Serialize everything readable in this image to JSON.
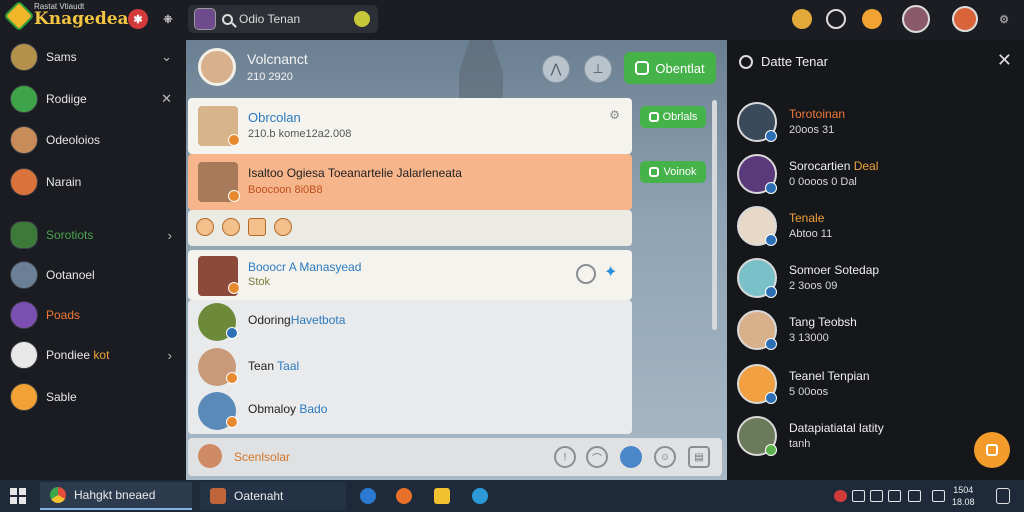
{
  "app": {
    "brand_sub": "Rastat Vtiaudt",
    "brand_name": "Knagedeaf"
  },
  "topbar": {
    "search_text": "Odio Tenan"
  },
  "sidebar": {
    "items": [
      {
        "label": "Sams",
        "alt": "",
        "right": "⌄",
        "color": "#b5924c"
      },
      {
        "label": "Rodiige",
        "alt": "",
        "right": "✕",
        "color": "#3fa34a"
      },
      {
        "label": "Odeoloios",
        "alt": "",
        "right": "",
        "color": "#c88b5a"
      },
      {
        "label": "Narain",
        "alt": "",
        "right": "",
        "color": "#d9733b"
      },
      {
        "label": "Sorotiots",
        "alt": "",
        "right": "›",
        "color": "#3d7a3a"
      },
      {
        "label": "Ootanoel",
        "alt": "",
        "right": "",
        "color": "#6b8096"
      },
      {
        "label": "Poads",
        "alt": "",
        "right": "",
        "color": "#7a4fb1"
      },
      {
        "label": "Pondiee",
        "alt": "kot",
        "right": "›",
        "color": "#e8e8e8"
      },
      {
        "label": "Sable",
        "alt": "",
        "right": "",
        "color": "#f2a135"
      }
    ]
  },
  "chat": {
    "title": "Volcnanct",
    "subtitle": "210 2920",
    "action_button": "Obentlat",
    "messages": [
      {
        "name": "Obrcolan",
        "line": "210.b kome12a2.008",
        "text": "",
        "text_blue": "",
        "button": "Obrlals",
        "av": "#d8b48a"
      },
      {
        "name": "",
        "line": "Boocoon 8i0B8",
        "text": "Isaltoo Ogiesa Toeanartelie Jalarleneata",
        "text_blue": "",
        "button": "Voinok",
        "av": "#a87a5a"
      },
      {
        "name": "Booocr A Manasyead",
        "line": "Stok",
        "text": "",
        "text_blue": "",
        "button": "",
        "av": "#8b4a3a"
      },
      {
        "name": "",
        "line": "",
        "text": "Odoring",
        "text_blue": "Havetbota",
        "button": "",
        "av": "#6d8a3a"
      },
      {
        "name": "",
        "line": "",
        "text": "Tean",
        "text_blue": "Taal",
        "button": "",
        "av": "#c99a7a"
      },
      {
        "name": "",
        "line": "",
        "text": "Obmaloy",
        "text_blue": "Bado",
        "button": "",
        "av": "#5a8ab8"
      }
    ],
    "footer_label": "Scenlsolar"
  },
  "right_panel": {
    "title": "Datte Tenar",
    "contacts": [
      {
        "name": "Torotoinan",
        "name_color": "#f07a3a",
        "sub": "20oos 31",
        "av": "#3a4a5a"
      },
      {
        "name": "Sorocartien",
        "name_alt": "Deal",
        "name_color": "#efefef",
        "sub": "0 0ooos 0 Dal",
        "av": "#5a3a7a"
      },
      {
        "name": "Tenale",
        "name_color": "#f0a43a",
        "sub": "Abtoo 11",
        "av": "#e8d8c8"
      },
      {
        "name": "Somoer Sotedap",
        "name_color": "#efefef",
        "sub": "2 3oos 09",
        "av": "#7ac0c8"
      },
      {
        "name": "Tang Teobsh",
        "name_color": "#efefef",
        "sub": "3 13000",
        "av": "#d8b08a"
      },
      {
        "name": "Teanel Tenpian",
        "name_color": "#efefef",
        "sub": "5 00oos",
        "av": "#f0a040"
      },
      {
        "name": "Datapiatiatal latity",
        "name_color": "#efefef",
        "sub": "tanh",
        "av": "#6a7a5a"
      }
    ]
  },
  "taskbar": {
    "tasks": [
      {
        "label": "Hahgkt bneaed"
      },
      {
        "label": "Oatenaht"
      }
    ],
    "clock_line1": "1504",
    "clock_line2": "18.08"
  },
  "colors": {
    "accent_green": "#46b24a",
    "accent_orange": "#f39b2b",
    "highlight": "#f7b58b"
  }
}
